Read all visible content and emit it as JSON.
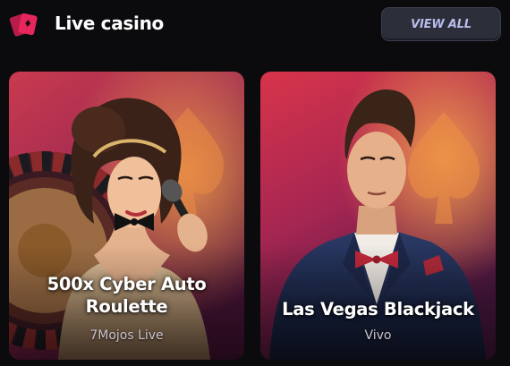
{
  "header": {
    "title": "Live casino",
    "view_all_label": "VIEW ALL",
    "icon": "cards-icon",
    "icon_color": "#e8265e"
  },
  "games": [
    {
      "title_line1": "500x Cyber Auto",
      "title_line2": "Roulette",
      "provider": "7Mojos Live"
    },
    {
      "title_line1": "Las Vegas Blackjack",
      "title_line2": "",
      "provider": "Vivo"
    }
  ],
  "colors": {
    "background": "#0b0b0e",
    "button_bg": "#2c2f3a",
    "button_text": "#b8bce8",
    "card_gradient_top": "#d8364a",
    "card_gradient_bottom": "#4a1840"
  }
}
